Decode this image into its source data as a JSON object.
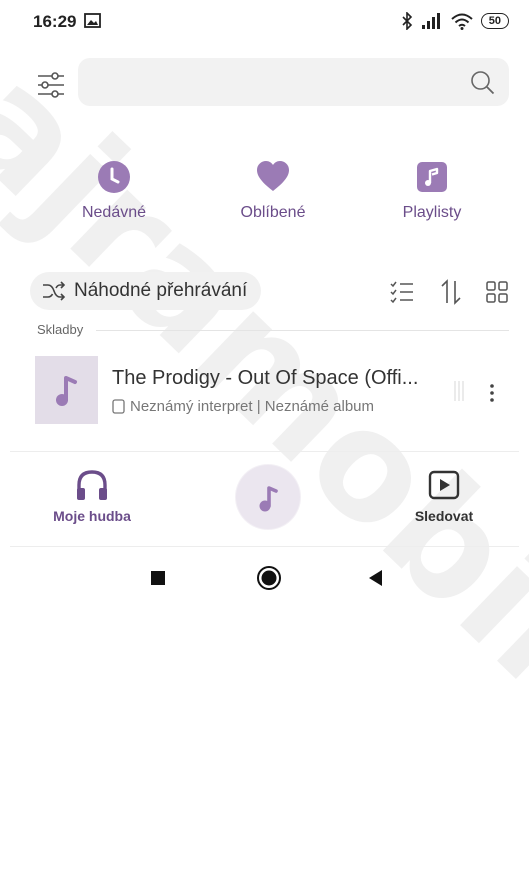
{
  "status_bar": {
    "time": "16:29",
    "battery": "50"
  },
  "search": {
    "placeholder": "",
    "value": ""
  },
  "categories": [
    {
      "label": "Nedávné",
      "icon": "clock-icon"
    },
    {
      "label": "Oblíbené",
      "icon": "heart-icon"
    },
    {
      "label": "Playlisty",
      "icon": "music-note-icon"
    }
  ],
  "shuffle": {
    "label": "Náhodné přehrávání"
  },
  "section": {
    "label": "Skladby"
  },
  "songs": [
    {
      "title": "The Prodigy - Out Of Space (Offi...",
      "subtitle": "Neznámý interpret | Neznámé album"
    }
  ],
  "bottom_nav": {
    "my_music": "Moje hudba",
    "watch": "Sledovat"
  },
  "watermark": "bajramobil.cz",
  "colors": {
    "accent": "#9b7bb5",
    "accent_dark": "#6b4d8a",
    "cover_bg": "#e3dde8"
  }
}
